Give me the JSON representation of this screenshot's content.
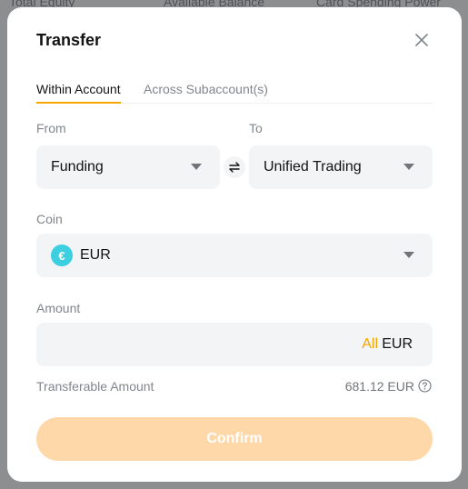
{
  "background": {
    "headers": [
      "Total Equity",
      "Available Balance",
      "Card Spending Power"
    ]
  },
  "modal": {
    "title": "Transfer",
    "tabs": [
      {
        "label": "Within Account",
        "active": true
      },
      {
        "label": "Across Subaccount(s)",
        "active": false
      }
    ],
    "from": {
      "label": "From",
      "value": "Funding"
    },
    "to": {
      "label": "To",
      "value": "Unified Trading"
    },
    "coin": {
      "label": "Coin",
      "value": "EUR",
      "icon_symbol": "€",
      "icon_color": "#3ccfe0"
    },
    "amount": {
      "label": "Amount",
      "value": "",
      "all_label": "All",
      "unit": "EUR"
    },
    "transferable": {
      "label": "Transferable Amount",
      "value": "681.12 EUR"
    },
    "confirm_label": "Confirm"
  },
  "colors": {
    "accent": "#f7a600",
    "confirm_disabled": "#fed8a8",
    "field_bg": "#f3f4f6"
  },
  "icons": {
    "close": "close-icon",
    "swap": "swap-arrows-icon",
    "caret": "caret-down-icon",
    "help": "question-circle-icon"
  }
}
